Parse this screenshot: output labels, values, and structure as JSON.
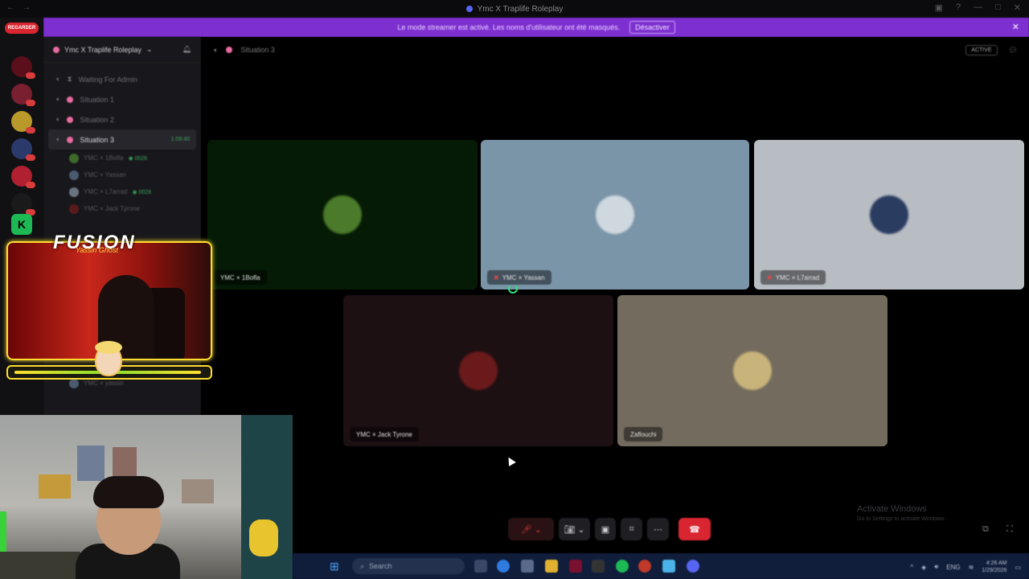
{
  "titlebar": {
    "title": "Ymc X Traplife Roleplay"
  },
  "banner": {
    "message": "Le mode streamer est activé. Les noms d'utilisateur ont été masqués.",
    "button_label": "Désactiver"
  },
  "rail": {
    "live_badge": "REGARDER"
  },
  "sidebar": {
    "server_name": "Ymc X Traplife Roleplay",
    "channels": [
      {
        "label": "Waiting For Admin"
      },
      {
        "label": "Situation 1"
      },
      {
        "label": "Situation 2"
      },
      {
        "label": "Situation 3",
        "active": true,
        "extra": "1:09:40"
      }
    ],
    "members": [
      {
        "label": "YMC × 1Bofla",
        "tag": "◉ 0026"
      },
      {
        "label": "YMC × Yassan"
      },
      {
        "label": "YMC × L7arrad",
        "tag": "◉ 0026"
      },
      {
        "label": "YMC × Jack Tyrone"
      },
      {
        "label": "YMC × yassin"
      }
    ]
  },
  "call": {
    "channel_title": "Situation 3",
    "status_pill": "ACTIVE",
    "tiles": [
      {
        "name": "YMC × 1Bofla",
        "avatar_color": "#4a7a2a"
      },
      {
        "name": "YMC × Yassan",
        "avatar_color": "#cfd8df"
      },
      {
        "name": "YMC × L7arrad",
        "avatar_color": "#2a3c60"
      },
      {
        "name": "YMC × Jack Tyrone",
        "avatar_color": "#6a1a1a"
      },
      {
        "name": "Zaflouchi",
        "avatar_color": "#c8b37a"
      }
    ]
  },
  "overlay": {
    "title": "FUSION",
    "subtitle": "Yassin Ghost"
  },
  "activate": {
    "title": "Activate Windows",
    "subtitle": "Go to Settings to activate Windows."
  },
  "taskbar": {
    "search_placeholder": "Search",
    "lang": "ENG",
    "time": "4:26 AM",
    "date": "1/29/2026"
  },
  "colors": {
    "accent": "#7d2fd0",
    "hangup": "#d8252f",
    "online": "#3aa55d",
    "frame": "#ffdd2e"
  }
}
